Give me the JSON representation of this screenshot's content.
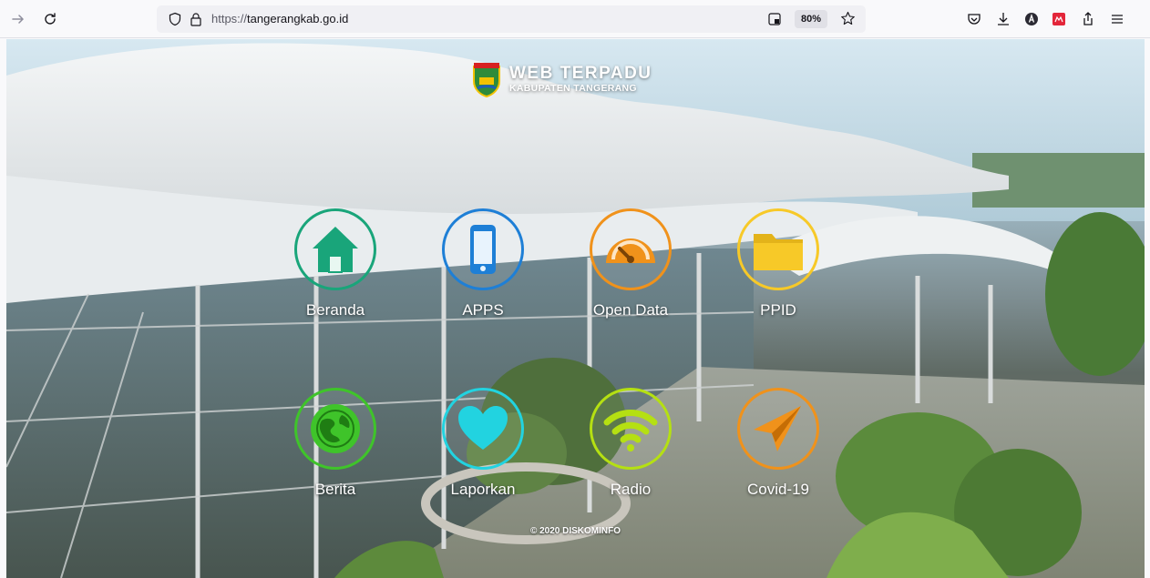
{
  "browser": {
    "url_scheme": "https://",
    "url_host": "tangerangkab.go.id",
    "zoom": "80%"
  },
  "page": {
    "logo": {
      "title": "WEB TERPADU",
      "subtitle": "KABUPATEN TANGERANG"
    },
    "menu": [
      {
        "label": "Beranda",
        "icon": "home-icon",
        "color": "#19a57a"
      },
      {
        "label": "APPS",
        "icon": "smartphone-icon",
        "color": "#1e7fd6"
      },
      {
        "label": "Open Data",
        "icon": "dashboard-gauge-icon",
        "color": "#f0921b"
      },
      {
        "label": "PPID",
        "icon": "folder-icon",
        "color": "#f7c928"
      },
      {
        "label": "Berita",
        "icon": "globe-icon",
        "color": "#3fc42a"
      },
      {
        "label": "Laporkan",
        "icon": "heart-icon",
        "color": "#22d3e0"
      },
      {
        "label": "Radio",
        "icon": "wifi-icon",
        "color": "#b5e012"
      },
      {
        "label": "Covid-19",
        "icon": "paper-plane-icon",
        "color": "#f0921b"
      }
    ],
    "footer": "© 2020 DISKOMINFO"
  }
}
